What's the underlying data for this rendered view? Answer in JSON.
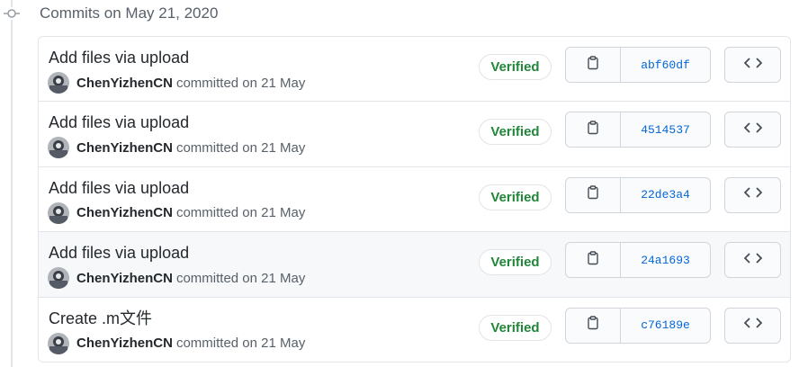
{
  "group": {
    "header": "Commits on May 21, 2020"
  },
  "commits": [
    {
      "title": "Add files via upload",
      "author": "ChenYizhenCN",
      "date_text": "committed on 21 May",
      "verified": "Verified",
      "sha": "abf60df"
    },
    {
      "title": "Add files via upload",
      "author": "ChenYizhenCN",
      "date_text": "committed on 21 May",
      "verified": "Verified",
      "sha": "4514537"
    },
    {
      "title": "Add files via upload",
      "author": "ChenYizhenCN",
      "date_text": "committed on 21 May",
      "verified": "Verified",
      "sha": "22de3a4"
    },
    {
      "title": "Add files via upload",
      "author": "ChenYizhenCN",
      "date_text": "committed on 21 May",
      "verified": "Verified",
      "sha": "24a1693"
    },
    {
      "title": "Create .m文件",
      "author": "ChenYizhenCN",
      "date_text": "committed on 21 May",
      "verified": "Verified",
      "sha": "c76189e"
    }
  ],
  "icons": {
    "timeline": "git-commit-icon",
    "copy": "clipboard-icon",
    "browse": "code-icon"
  },
  "colors": {
    "verified": "#22863a",
    "sha_link": "#0366d6",
    "border": "#e1e4e8",
    "hover_row": "#f6f8fa"
  }
}
